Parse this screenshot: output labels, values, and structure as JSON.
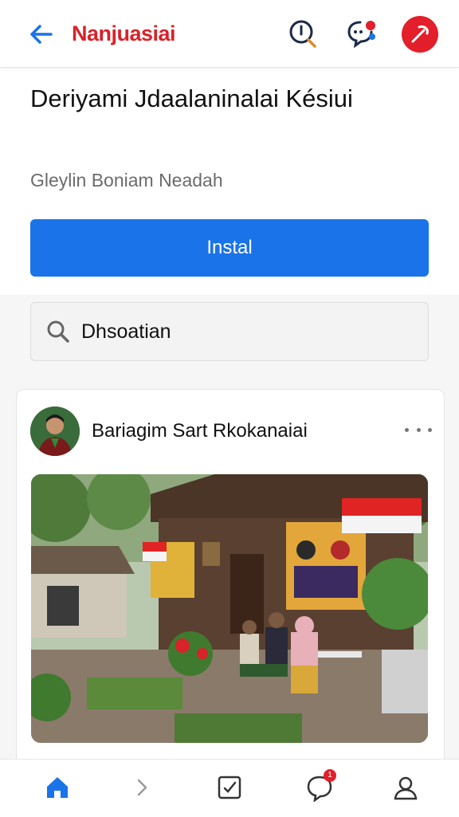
{
  "header": {
    "title": "Nanjuasiai",
    "back_icon": "arrow-left-icon",
    "icons": [
      "search-icon",
      "chat-notification-icon",
      "profile-icon"
    ],
    "accent_color": "#d8222a"
  },
  "hero": {
    "headline": "Deriyami Jdaalaninalai Késiui",
    "subline": "Gleylin Boniam Neadah",
    "install_label": "Instal",
    "install_color": "#1a73e8"
  },
  "search": {
    "value": "Dhsoatian",
    "icon": "search-icon"
  },
  "post": {
    "author": "Bariagim Sart Rkokanaiai",
    "more_icon": "more-horizontal-icon",
    "photo": "community-house-photo"
  },
  "bottom_nav": {
    "items": [
      {
        "icon": "home-icon",
        "active": true
      },
      {
        "icon": "chevron-right-icon",
        "active": false
      },
      {
        "icon": "edit-note-icon",
        "active": false
      },
      {
        "icon": "chat-icon",
        "active": false,
        "badge": "1"
      },
      {
        "icon": "profile-icon",
        "active": false
      }
    ],
    "active_color": "#1a73e8"
  }
}
